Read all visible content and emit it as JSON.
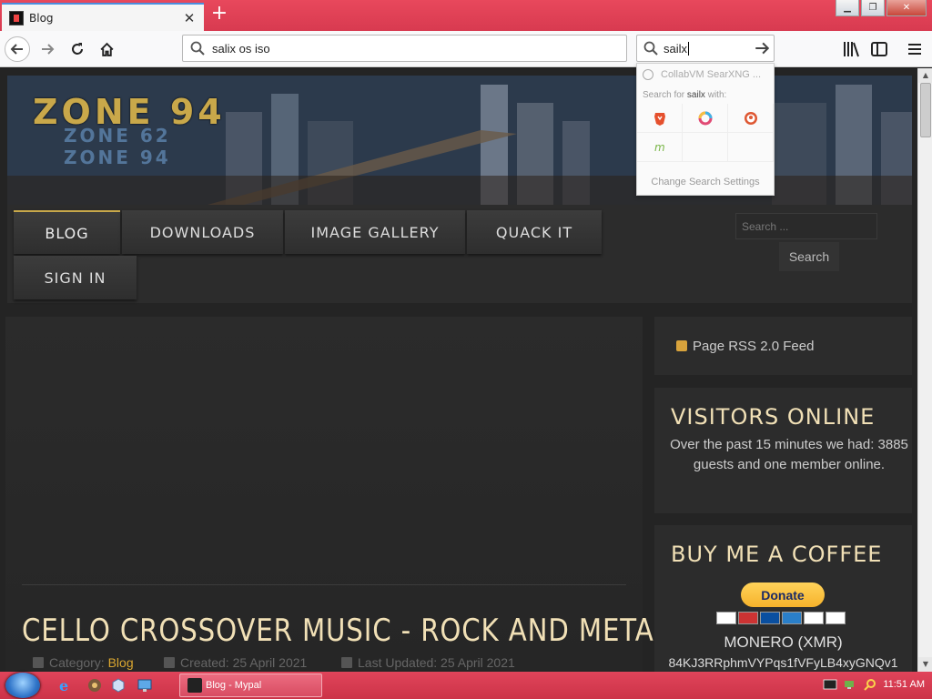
{
  "browser": {
    "tab_title": "Blog",
    "tab_close": "✕",
    "new_tab": "+",
    "url": "salix os iso",
    "search_query": "sailx"
  },
  "search_dropdown": {
    "suggestion": "CollabVM SearXNG ...",
    "search_for_prefix": "Search for",
    "search_for_term": "sailx",
    "search_for_suffix": "with:",
    "engines": [
      "brave-icon",
      "qwant-icon",
      "duckduckgo-icon",
      "mojeek-icon"
    ],
    "settings_label": "Change Search Settings"
  },
  "site": {
    "logo": "ZONE 94",
    "logo_sub1": "ZONE 62",
    "logo_sub2": "ZONE 94",
    "menu": [
      {
        "label": "BLOG",
        "active": true
      },
      {
        "label": "DOWNLOADS"
      },
      {
        "label": "IMAGE GALLERY"
      },
      {
        "label": "QUACK IT"
      },
      {
        "label": "SIGN IN"
      }
    ],
    "search_placeholder": "Search ...",
    "search_button": "Search"
  },
  "article": {
    "title": "CELLO CROSSOVER MUSIC - ROCK AND METAL",
    "category_label": "Category:",
    "category_value": "Blog",
    "created": "Created: 25 April 2021",
    "updated": "Last Updated: 25 April 2021"
  },
  "sidebar": {
    "rss_label": "Page RSS 2.0 Feed",
    "visitors_title": "VISITORS ONLINE",
    "visitors_text": "Over the past 15 minutes we had: 3885 guests and one member online.",
    "coffee_title": "BUY ME A COFFEE",
    "donate_label": "Donate",
    "monero_label": "MONERO (XMR)",
    "monero_address": "84KJ3RRphmVYPqs1fVFyLB4xyGNQv1"
  },
  "taskbar": {
    "task_label": "Blog - Mypal",
    "clock": "11:51 AM"
  },
  "colors": {
    "title_bar": "#d83a50",
    "accent_gold": "#c8a84a",
    "heading_cream": "#f1e0b6",
    "link_orange": "#d9a630",
    "page_bg": "#242424"
  }
}
